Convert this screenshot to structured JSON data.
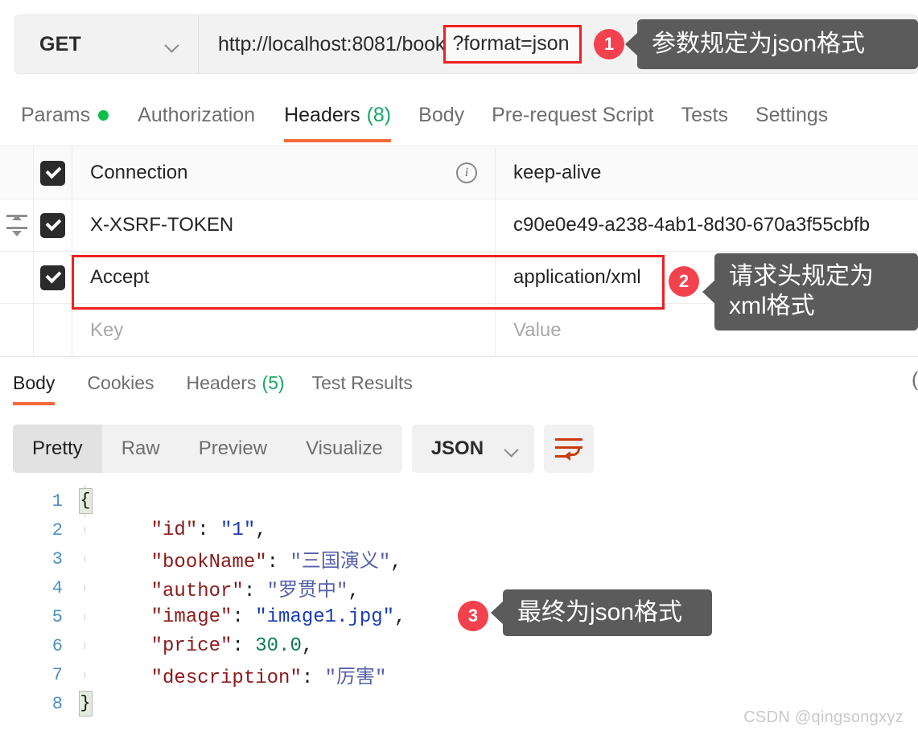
{
  "request_bar": {
    "method": "GET",
    "method_dropdown_icon": "chevron-down-icon",
    "url_prefix": "http://localhost:8081/book",
    "url_highlight": "?format=json",
    "url_full": "http://localhost:8081/book?format=json"
  },
  "request_tabs": [
    {
      "label": "Params",
      "active": false,
      "badge_dot": true,
      "count": ""
    },
    {
      "label": "Authorization",
      "active": false,
      "badge_dot": false,
      "count": ""
    },
    {
      "label": "Headers",
      "active": true,
      "badge_dot": false,
      "count": "(8)"
    },
    {
      "label": "Body",
      "active": false,
      "badge_dot": false,
      "count": ""
    },
    {
      "label": "Pre-request Script",
      "active": false,
      "badge_dot": false,
      "count": ""
    },
    {
      "label": "Tests",
      "active": false,
      "badge_dot": false,
      "count": ""
    },
    {
      "label": "Settings",
      "active": false,
      "badge_dot": false,
      "count": ""
    }
  ],
  "headers_table": {
    "columns": [
      "Key",
      "Value"
    ],
    "key_placeholder": "Key",
    "value_placeholder": "Value",
    "rows": [
      {
        "checked": true,
        "key": "Connection",
        "value": "keep-alive",
        "has_info_icon": true,
        "has_sort_handle": false
      },
      {
        "checked": true,
        "key": "X-XSRF-TOKEN",
        "value": "c90e0e49-a238-4ab1-8d30-670a3f55cbfb",
        "has_info_icon": false,
        "has_sort_handle": true
      },
      {
        "checked": true,
        "key": "Accept",
        "value": "application/xml",
        "has_info_icon": false,
        "has_sort_handle": false
      },
      {
        "checked": false,
        "key": "",
        "value": "",
        "has_info_icon": false,
        "has_sort_handle": false
      }
    ]
  },
  "response_tabs": [
    {
      "label": "Body",
      "active": true,
      "count": ""
    },
    {
      "label": "Cookies",
      "active": false,
      "count": ""
    },
    {
      "label": "Headers",
      "active": false,
      "count": "(5)"
    },
    {
      "label": "Test Results",
      "active": false,
      "count": ""
    }
  ],
  "response_tabs_cut_text": "(",
  "view_toolbar": {
    "segments": [
      {
        "label": "Pretty",
        "active": true
      },
      {
        "label": "Raw",
        "active": false
      },
      {
        "label": "Preview",
        "active": false
      },
      {
        "label": "Visualize",
        "active": false
      }
    ],
    "format": "JSON",
    "format_dropdown_icon": "chevron-down-icon",
    "wrap_button_icon": "text-wrap-icon"
  },
  "code": {
    "language": "json",
    "line_numbers": [
      "1",
      "2",
      "3",
      "4",
      "5",
      "6",
      "7",
      "8"
    ],
    "lines": [
      {
        "num": "1",
        "fold": "{",
        "tokens": []
      },
      {
        "num": "2",
        "fold": "",
        "tokens": [
          {
            "t": "    \"id\"",
            "c": "k"
          },
          {
            "t": ": ",
            "c": "p"
          },
          {
            "t": "\"1\"",
            "c": "s"
          },
          {
            "t": ",",
            "c": "p"
          }
        ]
      },
      {
        "num": "3",
        "fold": "",
        "tokens": [
          {
            "t": "    \"bookName\"",
            "c": "k"
          },
          {
            "t": ": ",
            "c": "p"
          },
          {
            "t": "\"三国演义\"",
            "c": "cn"
          },
          {
            "t": ",",
            "c": "p"
          }
        ]
      },
      {
        "num": "4",
        "fold": "",
        "tokens": [
          {
            "t": "    \"author\"",
            "c": "k"
          },
          {
            "t": ": ",
            "c": "p"
          },
          {
            "t": "\"罗贯中\"",
            "c": "cn"
          },
          {
            "t": ",",
            "c": "p"
          }
        ]
      },
      {
        "num": "5",
        "fold": "",
        "tokens": [
          {
            "t": "    \"image\"",
            "c": "k"
          },
          {
            "t": ": ",
            "c": "p"
          },
          {
            "t": "\"image1.jpg\"",
            "c": "s"
          },
          {
            "t": ",",
            "c": "p"
          }
        ]
      },
      {
        "num": "6",
        "fold": "",
        "tokens": [
          {
            "t": "    \"price\"",
            "c": "k"
          },
          {
            "t": ": ",
            "c": "p"
          },
          {
            "t": "30.0",
            "c": "n"
          },
          {
            "t": ",",
            "c": "p"
          }
        ]
      },
      {
        "num": "7",
        "fold": "",
        "tokens": [
          {
            "t": "    \"description\"",
            "c": "k"
          },
          {
            "t": ": ",
            "c": "p"
          },
          {
            "t": "\"厉害\"",
            "c": "cn"
          }
        ]
      },
      {
        "num": "8",
        "fold": "}",
        "tokens": []
      }
    ]
  },
  "annotations": [
    {
      "number": "1",
      "text": "参数规定为json格式"
    },
    {
      "number": "2",
      "text": "请求头规定为\nxml格式"
    },
    {
      "number": "3",
      "text": "最终为json格式"
    }
  ],
  "watermark": "CSDN @qingsongxyz",
  "colors": {
    "accent_orange": "#f26b3a",
    "badge_red": "#f4414e",
    "highlight_red": "#f02020",
    "tooltip_gray": "#5b5b5b",
    "count_green": "#18a864",
    "dot_green": "#0fbf4c"
  }
}
